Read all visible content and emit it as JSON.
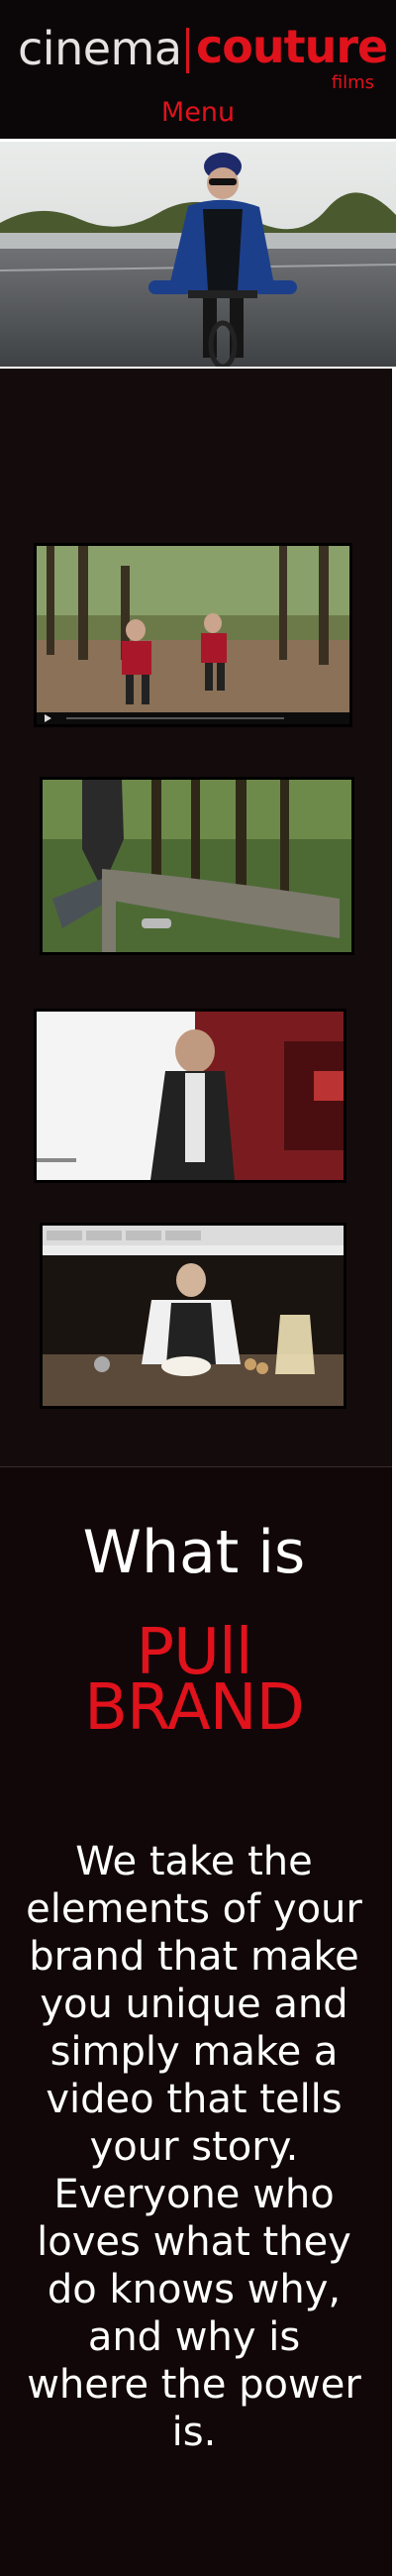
{
  "header": {
    "logo": {
      "cinema": "cinema",
      "couture": "couture",
      "films": "films"
    },
    "menu_label": "Menu"
  },
  "videos": {
    "items": [
      {
        "name": "Forest run video"
      },
      {
        "name": "Log jump video"
      },
      {
        "name": "Studio interview video"
      },
      {
        "name": "Kitchen baking video"
      }
    ],
    "player_icon": "play-controls-icon"
  },
  "about": {
    "heading": "What is",
    "brand_lines": [
      "PUll",
      "BRAND"
    ],
    "body": "We take the elements of your brand that make you unique and simply make a video that tells your story. Everyone who loves what they do knows why, and why is where the power is."
  },
  "colors": {
    "brand_red": "#e0121c",
    "background_dark": "#110709",
    "text_light": "#ffffff"
  }
}
